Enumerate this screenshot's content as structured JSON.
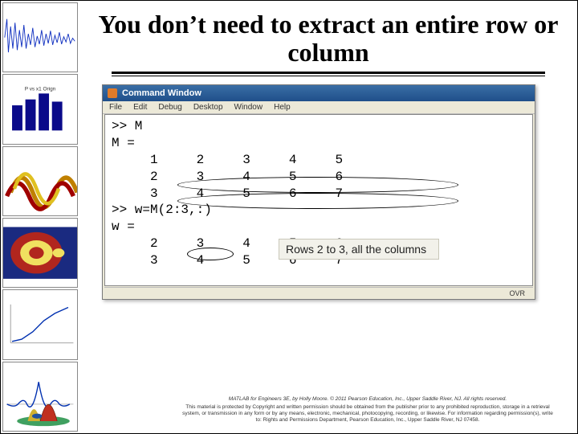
{
  "title": "You don’t need to extract an entire row or column",
  "cmdwin": {
    "title": "Command Window",
    "menu": [
      "File",
      "Edit",
      "Debug",
      "Desktop",
      "Window",
      "Help"
    ],
    "status": "OVR",
    "lines": {
      "l1": ">> M",
      "l2": "M =",
      "l3": "     1     2     3     4     5",
      "l4": "     2     3     4     5     6",
      "l5": "     3     4     5     6     7",
      "l6": ">> w=M(2:3,:)",
      "l7": "w =",
      "l8": "     2     3     4     5     6",
      "l9": "     3     4     5     6     7"
    }
  },
  "callout": "Rows 2 to 3, all the columns",
  "footer": {
    "line1": "MATLAB for Engineers 3E, by Holly Moore. © 2011 Pearson Education, Inc., Upper Saddle River, NJ.  All rights reserved.",
    "line2": "This material is protected by Copyright and written permission should be obtained from the publisher prior to any prohibited reproduction, storage in a retrieval system, or transmission in any form or by any means, electronic, mechanical, photocopying, recording, or likewise. For information regarding permission(s), write to: Rights and Permissions Department, Pearson Education, Inc., Upper Saddle River, NJ 07458."
  }
}
